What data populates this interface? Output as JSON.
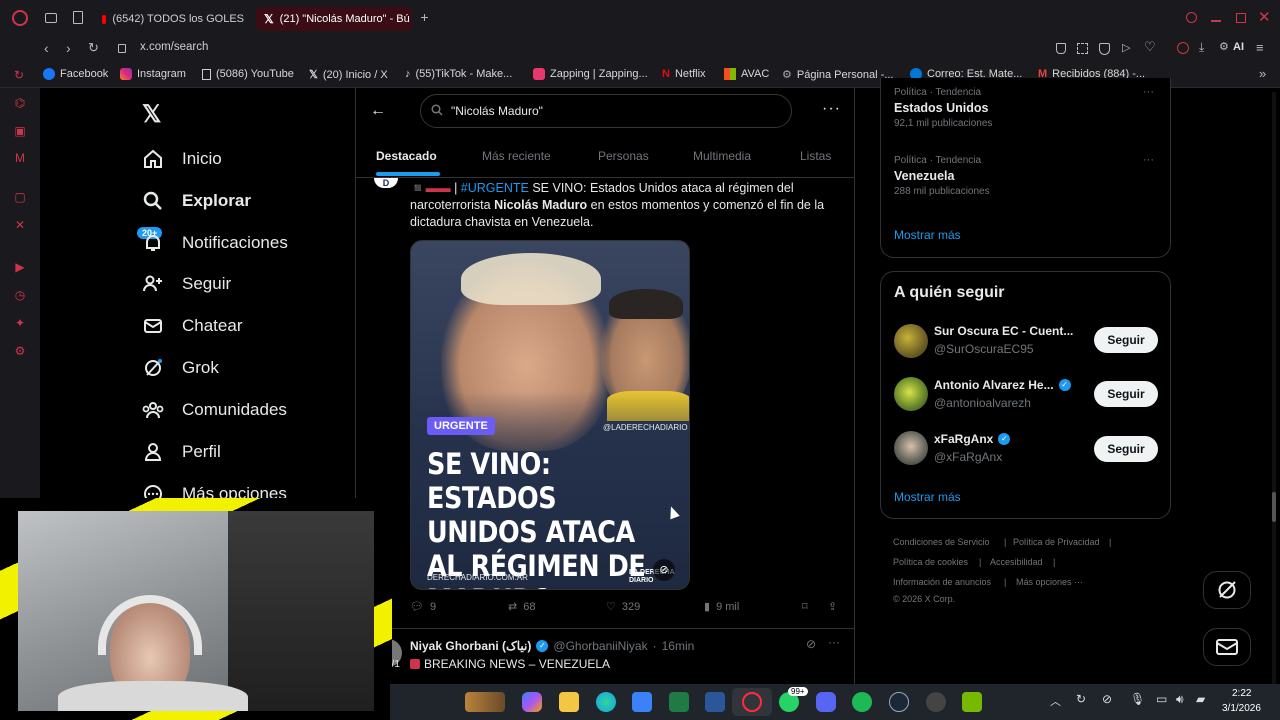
{
  "browser": {
    "tabs": [
      {
        "label": "(6542) TODOS los GOLES"
      },
      {
        "label": "(21) \"Nicolás Maduro\" - Bú"
      }
    ],
    "url": "x.com/search",
    "ai_label": "AI",
    "bookmarks": [
      "Facebook",
      "Instagram",
      "(5086) YouTube",
      "(20) Inicio / X",
      "(55)TikTok - Make...",
      "Zapping | Zapping...",
      "Netflix",
      "AVAC",
      "Página Personal -...",
      "Correo: Est. Mate...",
      "Recibidos (884) -..."
    ]
  },
  "nav": {
    "items": [
      "Inicio",
      "Explorar",
      "Notificaciones",
      "Seguir",
      "Chatear",
      "Grok",
      "Comunidades",
      "Perfil",
      "Más opciones"
    ],
    "notif_badge": "20+"
  },
  "search": {
    "query": "\"Nicolás Maduro\""
  },
  "tabs": [
    "Destacado",
    "Más reciente",
    "Personas",
    "Multimedia",
    "Listas"
  ],
  "tweet": {
    "hashtag": "#URGENTE",
    "text_1": " SE VINO: Estados Unidos ataca al régimen del narcoterrorista ",
    "bold_name": "Nicolás Maduro",
    "text_2": " en estos momentos y comenzó el fin de la dictadura chavista en Venezuela.",
    "media": {
      "badge": "URGENTE",
      "handle": "@LADERECHADIARIO",
      "headline": "SE VINO: ESTADOS UNIDOS ATACA AL RÉGIMEN DE MADURO",
      "footer": "DERECHADIARIO.COM.AR",
      "logo_text": "LA DERECHA DIARIO"
    },
    "replies": "9",
    "reposts": "68",
    "likes": "329",
    "views": "9 mil"
  },
  "tweet2": {
    "name": "Niyak Ghorbani (نیاک)",
    "handle": "@GhorbaniiNiyak",
    "time": "16min",
    "text": "BREAKING NEWS – VENEZUELA",
    "sep": "·",
    "left_fragment": "o/1"
  },
  "trends": [
    {
      "category": "Política · Tendencia",
      "name": "Estados Unidos",
      "count": "92,1 mil publicaciones"
    },
    {
      "category": "Política · Tendencia",
      "name": "Venezuela",
      "count": "288 mil publicaciones"
    }
  ],
  "show_more": "Mostrar más",
  "who_to_follow": {
    "title": "A quién seguir",
    "users": [
      {
        "name": "Sur Oscura EC - Cuent...",
        "handle": "@SurOscuraEC95"
      },
      {
        "name": "Antonio Alvarez He...",
        "handle": "@antonioalvarezh"
      },
      {
        "name": "xFaRgAnx",
        "handle": "@xFaRgAnx"
      }
    ],
    "follow_label": "Seguir",
    "show_more": "Mostrar más"
  },
  "footer": {
    "links": [
      "Condiciones de Servicio",
      "Política de Privacidad",
      "Política de cookies",
      "Accesibilidad",
      "Información de anuncios",
      "Más opciones ···"
    ],
    "copyright": "© 2026 X Corp."
  },
  "taskbar": {
    "time": "2:22",
    "date": "3/1/2026",
    "whatsapp_badge": "99+"
  },
  "colors": {
    "accent": "#1d9bf0",
    "opera_red": "#d0344a",
    "bg": "#000000"
  }
}
